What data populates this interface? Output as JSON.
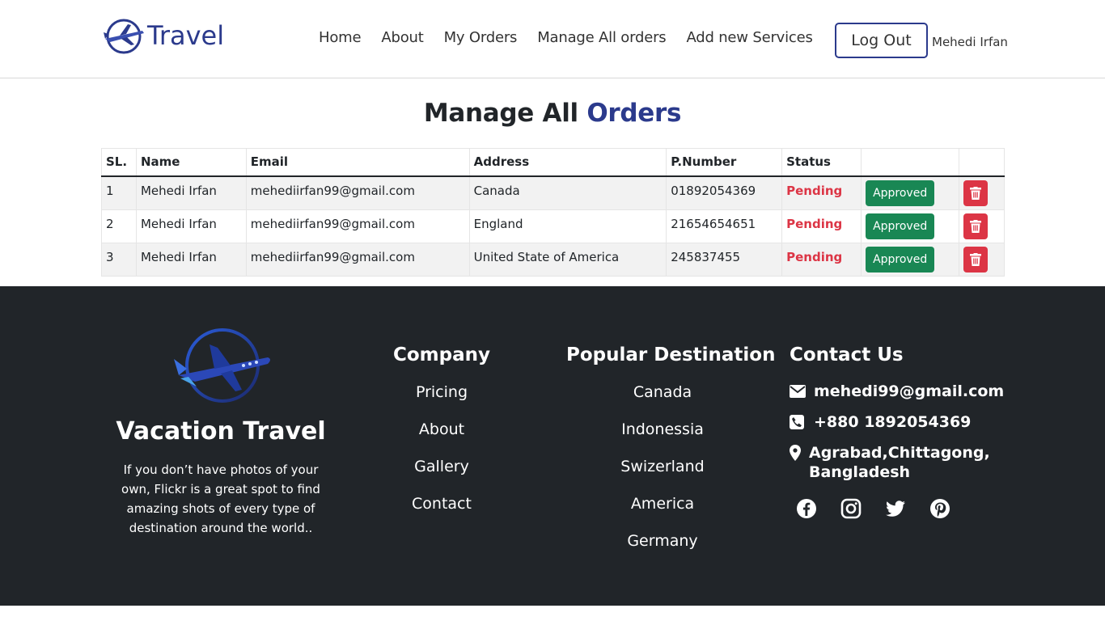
{
  "brand": {
    "name": "Travel"
  },
  "nav": {
    "links": [
      "Home",
      "About",
      "My Orders",
      "Manage All orders",
      "Add new Services"
    ],
    "logout_label": "Log Out",
    "user_name": "Mehedi Irfan"
  },
  "page": {
    "title_part1": "Manage All",
    "title_part2": "Orders"
  },
  "table": {
    "headers": [
      "SL.",
      "Name",
      "Email",
      "Address",
      "P.Number",
      "Status",
      ""
    ],
    "rows": [
      {
        "sl": "1",
        "name": "Mehedi Irfan",
        "email": "mehediirfan99@gmail.com",
        "address": "Canada",
        "phone": "01892054369",
        "status": "Pending",
        "action": "Approved"
      },
      {
        "sl": "2",
        "name": "Mehedi Irfan",
        "email": "mehediirfan99@gmail.com",
        "address": "England",
        "phone": "21654654651",
        "status": "Pending",
        "action": "Approved"
      },
      {
        "sl": "3",
        "name": "Mehedi Irfan",
        "email": "mehediirfan99@gmail.com",
        "address": "United State of America",
        "phone": "245837455",
        "status": "Pending",
        "action": "Approved"
      }
    ]
  },
  "footer": {
    "brand_title": "Vacation Travel",
    "description": "If you don’t have photos of your own, Flickr is a great spot to find amazing shots of every type of destination around the world..",
    "company": {
      "heading": "Company",
      "links": [
        "Pricing",
        "About",
        "Gallery",
        "Contact"
      ]
    },
    "destinations": {
      "heading": "Popular Destination",
      "links": [
        "Canada",
        "Indonessia",
        "Swizerland",
        "America",
        "Germany"
      ]
    },
    "contact": {
      "heading": "Contact Us",
      "email": "mehedi99@gmail.com",
      "phone": "+880 1892054369",
      "address": "Agrabad,Chittagong, Bangladesh"
    },
    "socials": [
      "facebook-icon",
      "instagram-icon",
      "twitter-icon",
      "pinterest-icon"
    ]
  },
  "colors": {
    "brand": "#2b3a8c",
    "success": "#198754",
    "danger": "#dc3545",
    "footer_bg": "#212529"
  }
}
